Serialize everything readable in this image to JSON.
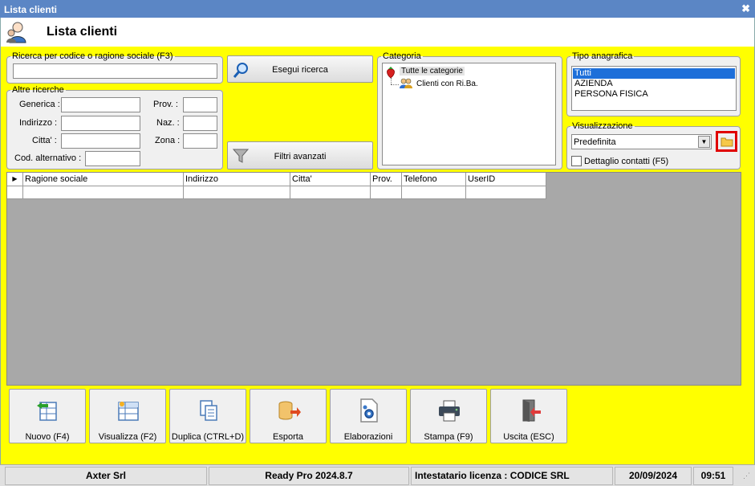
{
  "window": {
    "title": "Lista clienti",
    "close_glyph": "✖"
  },
  "header": {
    "title": "Lista clienti",
    "icon": "customers-icon"
  },
  "search": {
    "group_label": "Ricerca per codice o ragione sociale (F3)",
    "value": "",
    "button_label": "Esegui ricerca"
  },
  "other": {
    "group_label": "Altre ricerche",
    "generica": "Generica :",
    "indirizzo": "Indirizzo :",
    "citta": "Citta' :",
    "cod_alt": "Cod. alternativo :",
    "prov": "Prov. :",
    "naz": "Naz. :",
    "zona": "Zona :"
  },
  "filters": {
    "button_label": "Filtri avanzati"
  },
  "categoria": {
    "group_label": "Categoria",
    "root": "Tutte le categorie",
    "child": "Clienti con Ri.Ba."
  },
  "tipo": {
    "group_label": "Tipo anagrafica",
    "items": [
      "Tutti",
      "AZIENDA",
      "PERSONA FISICA"
    ],
    "selected": "Tutti"
  },
  "visual": {
    "group_label": "Visualizzazione",
    "selected": "Predefinita",
    "checkbox_label": "Dettaglio contatti (F5)"
  },
  "grid": {
    "columns": [
      "Ragione sociale",
      "Indirizzo",
      "Citta'",
      "Prov.",
      "Telefono",
      "UserID"
    ]
  },
  "toolbar": {
    "nuovo": "Nuovo (F4)",
    "visualizza": "Visualizza (F2)",
    "duplica": "Duplica (CTRL+D)",
    "esporta": "Esporta",
    "elaborazioni": "Elaborazioni",
    "stampa": "Stampa (F9)",
    "uscita": "Uscita (ESC)"
  },
  "status": {
    "company": "Axter Srl",
    "version": "Ready Pro 2024.8.7",
    "license": "Intestatario licenza : CODICE SRL",
    "date": "20/09/2024",
    "time": "09:51"
  },
  "colors": {
    "background_accent": "#ffff00",
    "title_bar": "#5b86c5",
    "selection": "#1e6fd9",
    "highlight_box": "#e00000"
  }
}
